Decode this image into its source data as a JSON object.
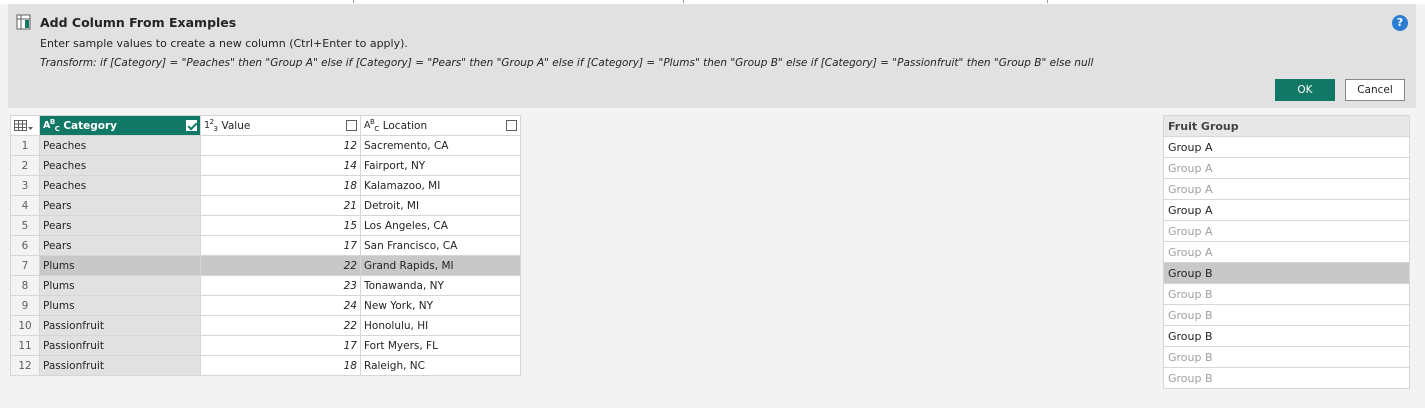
{
  "banner": {
    "title": "Add Column From Examples",
    "subtitle": "Enter sample values to create a new column (Ctrl+Enter to apply).",
    "formula": "Transform: if [Category] = \"Peaches\" then \"Group A\" else if [Category] = \"Pears\" then \"Group A\" else if [Category] = \"Plums\" then \"Group B\" else if [Category] = \"Passionfruit\" then \"Group B\" else null",
    "help": "?",
    "ok_label": "OK",
    "cancel_label": "Cancel"
  },
  "columns": {
    "category": {
      "type": "ABC",
      "label": "Category",
      "checked": true
    },
    "value": {
      "type": "123",
      "label": "Value",
      "checked": false
    },
    "location": {
      "type": "ABC",
      "label": "Location",
      "checked": false
    }
  },
  "rows": [
    {
      "n": "1",
      "category": "Peaches",
      "value": "12",
      "location": "Sacremento, CA"
    },
    {
      "n": "2",
      "category": "Peaches",
      "value": "14",
      "location": "Fairport, NY"
    },
    {
      "n": "3",
      "category": "Peaches",
      "value": "18",
      "location": "Kalamazoo, MI"
    },
    {
      "n": "4",
      "category": "Pears",
      "value": "21",
      "location": "Detroit, MI"
    },
    {
      "n": "5",
      "category": "Pears",
      "value": "15",
      "location": "Los Angeles, CA"
    },
    {
      "n": "6",
      "category": "Pears",
      "value": "17",
      "location": "San Francisco, CA"
    },
    {
      "n": "7",
      "category": "Plums",
      "value": "22",
      "location": "Grand Rapids, MI"
    },
    {
      "n": "8",
      "category": "Plums",
      "value": "23",
      "location": "Tonawanda, NY"
    },
    {
      "n": "9",
      "category": "Plums",
      "value": "24",
      "location": "New York, NY"
    },
    {
      "n": "10",
      "category": "Passionfruit",
      "value": "22",
      "location": "Honolulu, HI"
    },
    {
      "n": "11",
      "category": "Passionfruit",
      "value": "17",
      "location": "Fort Myers, FL"
    },
    {
      "n": "12",
      "category": "Passionfruit",
      "value": "18",
      "location": "Raleigh, NC"
    }
  ],
  "fruit_group": {
    "header": "Fruit Group",
    "cells": [
      "Group A",
      "Group A",
      "Group A",
      "Group A",
      "Group A",
      "Group A",
      "Group B",
      "Group B",
      "Group B",
      "Group B",
      "Group B",
      "Group B"
    ],
    "entered": [
      true,
      false,
      false,
      true,
      false,
      false,
      true,
      false,
      false,
      true,
      false,
      false
    ]
  },
  "selected_row": 7,
  "colors": {
    "accent": "#117865",
    "selected_row": "#c8c8c8",
    "help": "#2b7cd3"
  }
}
